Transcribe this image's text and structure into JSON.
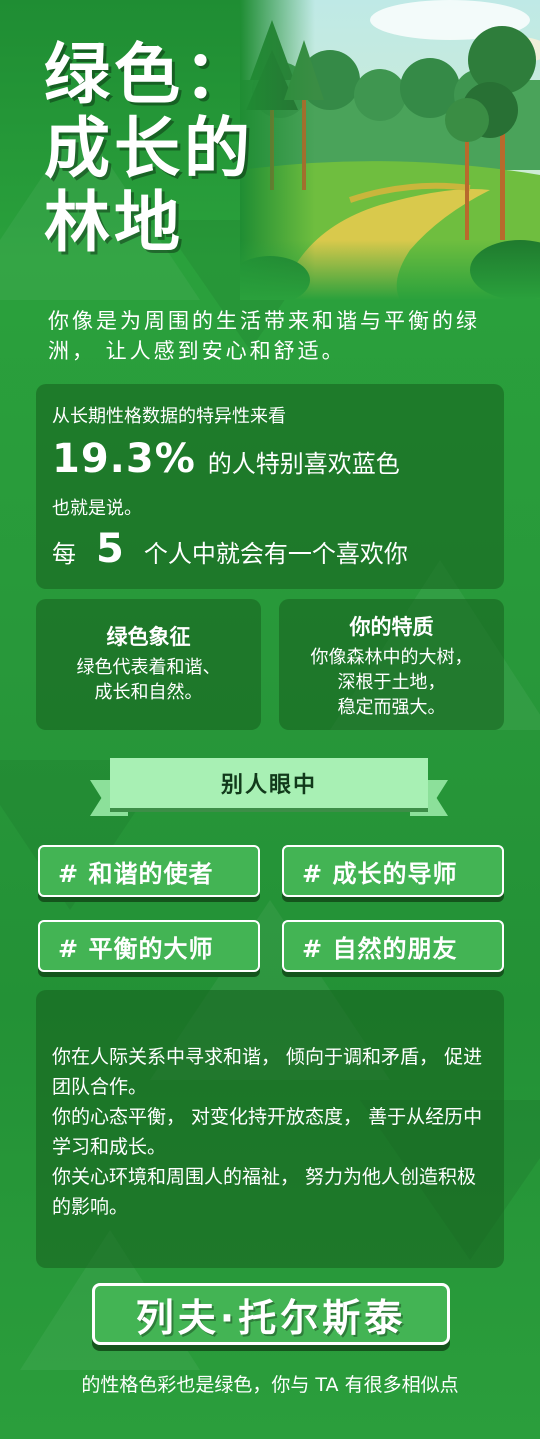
{
  "header": {
    "title": "绿色：\n成长的\n林地"
  },
  "intro": "你像是为周围的生活带来和谐与平衡的绿洲， 让人感到安心和舒适。",
  "stats": {
    "line1": "从长期性格数据的特异性来看",
    "percent": "19.3%",
    "percent_text": "的人特别喜欢蓝色",
    "line3": "也就是说。",
    "every": "每",
    "number": "5",
    "rest": "个人中就会有一个喜欢你"
  },
  "cards": {
    "symbol_title": "绿色象征",
    "symbol_body": "绿色代表着和谐、\n成长和自然。",
    "trait_title": "你的特质",
    "trait_body": "你像森林中的大树，\n深根于土地，\n稳定而强大。"
  },
  "ribbon": "别人眼中",
  "tags": [
    "# 和谐的使者",
    "# 成长的导师",
    "# 平衡的大师",
    "# 自然的朋友"
  ],
  "description": [
    "你在人际关系中寻求和谐， 倾向于调和矛盾， 促进团队合作。",
    "你的心态平衡， 对变化持开放态度， 善于从经历中学习和成长。",
    "你关心环境和周围人的福祉， 努力为他人创造积极的影响。"
  ],
  "person": "列夫·托尔斯泰",
  "footer": "的性格色彩也是绿色，你与 TA 有很多相似点",
  "colors": {
    "background": "#2a9a3a",
    "tag_fill": "#43b454",
    "ribbon_fill": "#a8f0b4",
    "panel": "#165f1e"
  }
}
